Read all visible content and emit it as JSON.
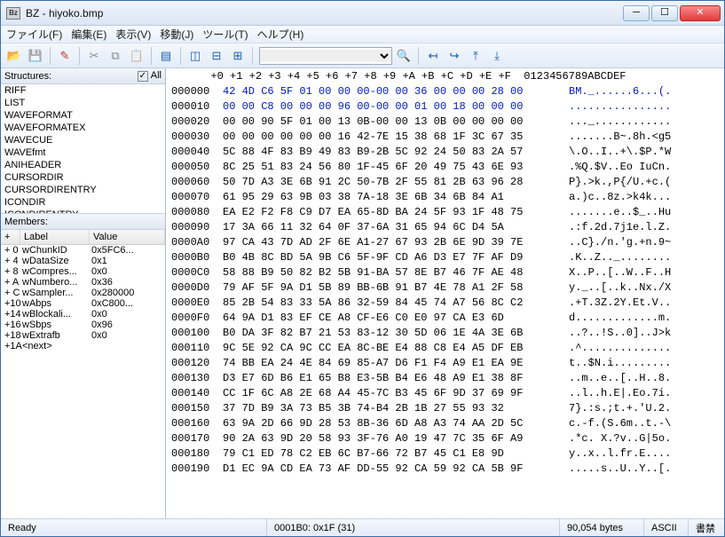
{
  "window": {
    "title": "BZ - hiyoko.bmp",
    "icon_label": "Bz"
  },
  "menus": [
    "ファイル(F)",
    "編集(E)",
    "表示(V)",
    "移動(J)",
    "ツール(T)",
    "ヘルプ(H)"
  ],
  "structures": {
    "header": "Structures:",
    "all_label": "All",
    "all_checked": true,
    "items": [
      "RIFF",
      "LIST",
      "WAVEFORMAT",
      "WAVEFORMATEX",
      "WAVECUE",
      "WAVEfmt",
      "ANIHEADER",
      "CURSORDIR",
      "CURSORDIRENTRY",
      "ICONDIR",
      "ICONDIRENTRY"
    ]
  },
  "members": {
    "header": "Members:",
    "cols": [
      "+",
      "Label",
      "Value"
    ],
    "rows": [
      [
        "+ 0",
        "wChunkID",
        "0x5FC6..."
      ],
      [
        "+ 4",
        "wDataSize",
        "0x1"
      ],
      [
        "+ 8",
        "wCompres...",
        "0x0"
      ],
      [
        "+ A",
        "wNumbero...",
        "0x36"
      ],
      [
        "+ C",
        "wSampler...",
        "0x280000"
      ],
      [
        "+10",
        "wAbps",
        "0xC800..."
      ],
      [
        "+14",
        "wBlockali...",
        "0x0"
      ],
      [
        "+16",
        "wSbps",
        "0x96"
      ],
      [
        "+18",
        "wExtrafb",
        "0x0"
      ],
      [
        "+1A",
        "<next>",
        ""
      ]
    ]
  },
  "hex": {
    "cols": "       +0 +1 +2 +3 +4 +5 +6 +7 +8 +9 +A +B +C +D +E +F  0123456789ABCDEF",
    "rows": [
      {
        "o": "000000",
        "h": "42 4D C6 5F 01 00 00 00-00 00 36 00 00 00 28 00",
        "a": "BM._......6...(.",
        "blue": true
      },
      {
        "o": "000010",
        "h": "00 00 C8 00 00 00 96 00-00 00 01 00 18 00 00 00",
        "a": "................",
        "blue": true
      },
      {
        "o": "000020",
        "h": "00 00 90 5F 01 00 13 0B-00 00 13 0B 00 00 00 00",
        "a": "..._............"
      },
      {
        "o": "000030",
        "h": "00 00 00 00 00 00 16 42-7E 15 38 68 1F 3C 67 35",
        "a": ".......B~.8h.<g5"
      },
      {
        "o": "000040",
        "h": "5C 88 4F 83 B9 49 83 B9-2B 5C 92 24 50 83 2A 57",
        "a": "\\.O..I..+\\.$P.*W"
      },
      {
        "o": "000050",
        "h": "8C 25 51 83 24 56 80 1F-45 6F 20 49 75 43 6E 93",
        "a": ".%Q.$V..Eo IuCn."
      },
      {
        "o": "000060",
        "h": "50 7D A3 3E 6B 91 2C 50-7B 2F 55 81 2B 63 96 28",
        "a": "P}.>k.,P{/U.+c.("
      },
      {
        "o": "000070",
        "h": "61 95 29 63 9B 03 38 7A-18 3E 6B 34 6B 84 A1    ",
        "a": "a.)c..8z.>k4k..."
      },
      {
        "o": "000080",
        "h": "EA E2 F2 F8 C9 D7 EA 65-8D BA 24 5F 93 1F 48 75",
        "a": ".......e..$_..Hu"
      },
      {
        "o": "000090",
        "h": "17 3A 66 11 32 64 0F 37-6A 31 65 94 6C D4 5A    ",
        "a": ".:f.2d.7j1e.l.Z."
      },
      {
        "o": "0000A0",
        "h": "97 CA 43 7D AD 2F 6E A1-27 67 93 2B 6E 9D 39 7E",
        "a": "..C}./n.'g.+n.9~"
      },
      {
        "o": "0000B0",
        "h": "B0 4B 8C BD 5A 9B C6 5F-9F CD A6 D3 E7 7F AF D9",
        "a": ".K..Z.._........"
      },
      {
        "o": "0000C0",
        "h": "58 88 B9 50 82 B2 5B 91-BA 57 8E B7 46 7F AE 48",
        "a": "X..P..[..W..F..H"
      },
      {
        "o": "0000D0",
        "h": "79 AF 5F 9A D1 5B 89 BB-6B 91 B7 4E 78 A1 2F 58",
        "a": "y._..[..k..Nx./X"
      },
      {
        "o": "0000E0",
        "h": "85 2B 54 83 33 5A 86 32-59 84 45 74 A7 56 8C C2",
        "a": ".+T.3Z.2Y.Et.V.."
      },
      {
        "o": "0000F0",
        "h": "64 9A D1 83 EF CE A8 CF-E6 C0 E0 97 CA E3 6D    ",
        "a": "d.............m."
      },
      {
        "o": "000100",
        "h": "B0 DA 3F 82 B7 21 53 83-12 30 5D 06 1E 4A 3E 6B",
        "a": "..?..!S..0]..J>k"
      },
      {
        "o": "000110",
        "h": "9C 5E 92 CA 9C CC EA 8C-BE E4 88 C8 E4 A5 DF EB",
        "a": ".^.............."
      },
      {
        "o": "000120",
        "h": "74 BB EA 24 4E 84 69 85-A7 D6 F1 F4 A9 E1 EA 9E",
        "a": "t..$N.i........."
      },
      {
        "o": "000130",
        "h": "D3 E7 6D B6 E1 65 B8 E3-5B B4 E6 48 A9 E1 38 8F",
        "a": "..m..e..[..H..8."
      },
      {
        "o": "000140",
        "h": "CC 1F 6C A8 2E 68 A4 45-7C B3 45 6F 9D 37 69 9F",
        "a": "..l..h.E|.Eo.7i."
      },
      {
        "o": "000150",
        "h": "37 7D B9 3A 73 B5 3B 74-B4 2B 1B 27 55 93 32    ",
        "a": "7}.:s.;t.+.'U.2."
      },
      {
        "o": "000160",
        "h": "63 9A 2D 66 9D 28 53 8B-36 6D A8 A3 74 AA 2D 5C",
        "a": "c.-f.(S.6m..t.-\\"
      },
      {
        "o": "000170",
        "h": "90 2A 63 9D 20 58 93 3F-76 A0 19 47 7C 35 6F A9",
        "a": ".*c. X.?v..G|5o."
      },
      {
        "o": "000180",
        "h": "79 C1 ED 78 C2 EB 6C B7-66 72 B7 45 C1 E8 9D    ",
        "a": "y..x..l.fr.E...."
      },
      {
        "o": "000190",
        "h": "D1 EC 9A CD EA 73 AF DD-55 92 CA 59 92 CA 5B 9F",
        "a": ".....s..U..Y..[."
      }
    ]
  },
  "status": {
    "ready": "Ready",
    "pos": "0001B0: 0x1F (31)",
    "size": "90,054 bytes",
    "mode": "ASCII",
    "ins": "書禁"
  }
}
